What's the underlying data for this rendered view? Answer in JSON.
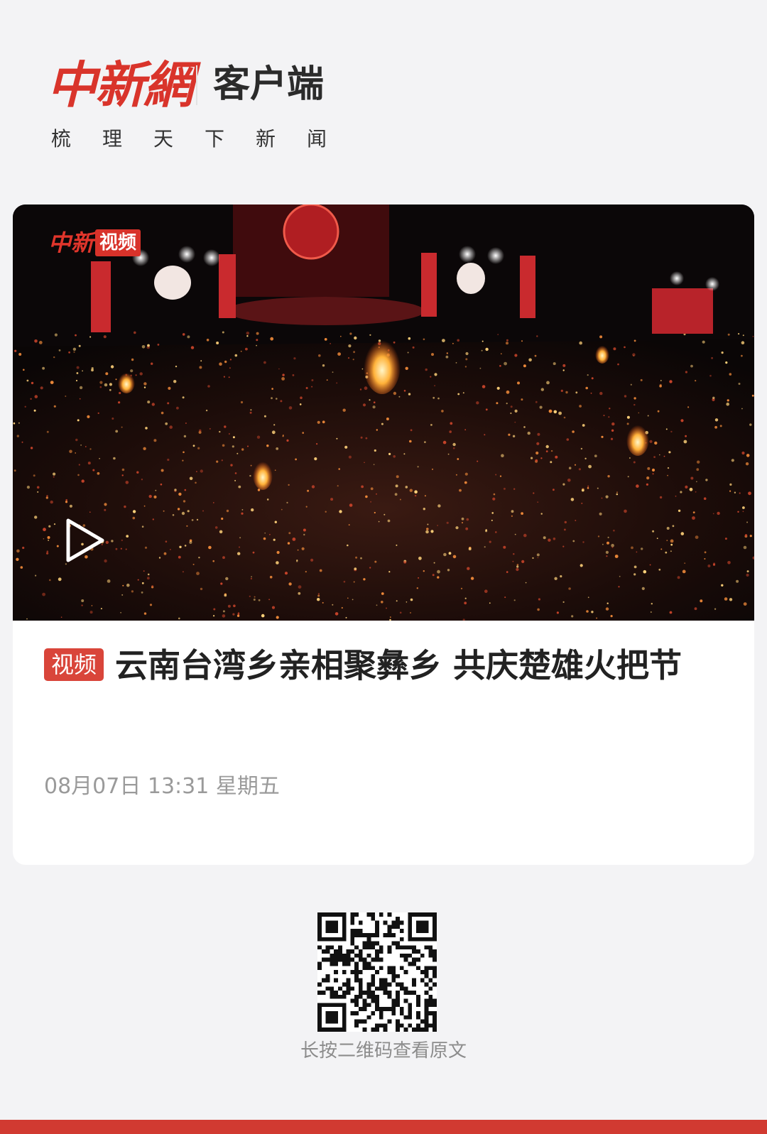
{
  "header": {
    "logo_text": "中新網",
    "app_name": "客户端",
    "slogan": "梳理天下新闻"
  },
  "card": {
    "video": {
      "watermark_red": "中新",
      "watermark_box": "视频"
    },
    "tag": "视频",
    "title": "云南台湾乡亲相聚彝乡  共庆楚雄火把节",
    "date": "08月07日 13:31 星期五"
  },
  "footer": {
    "qr_caption": "长按二维码查看原文"
  },
  "colors": {
    "brand_red": "#d9342b",
    "tag_red": "#d9453a",
    "bottom_bar": "#d13a31"
  }
}
